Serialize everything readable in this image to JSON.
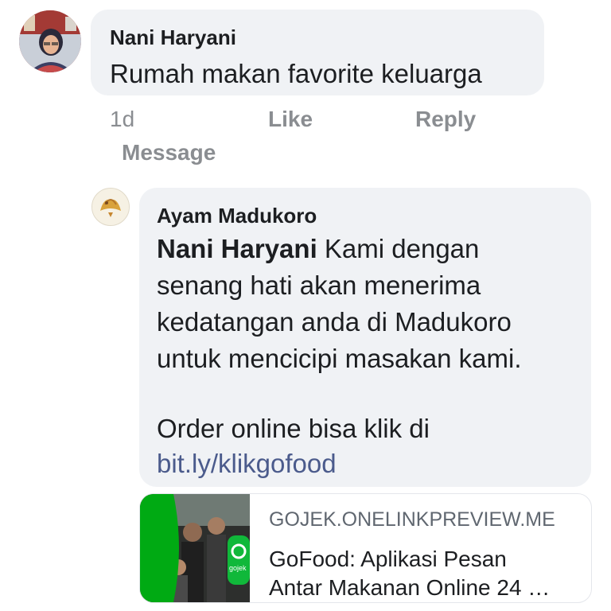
{
  "comment": {
    "author": "Nani Haryani",
    "text": "Rumah makan favorite keluarga",
    "time": "1d",
    "like": "Like",
    "reply": "Reply",
    "message": "Message"
  },
  "reply": {
    "author": "Ayam Madukoro",
    "mention": "Nani Haryani",
    "line1": "Kami dengan",
    "line2": "senang hati akan menerima",
    "line3": "kedatangan anda di Madukoro",
    "line4": "untuk mencicipi masakan kami.",
    "line5": "Order online bisa klik di",
    "link": "bit.ly/klikgofood"
  },
  "preview": {
    "domain": "GOJEK.ONELINKPREVIEW.ME",
    "title_line1": "GoFood: Aplikasi Pesan",
    "title_line2": "Antar Makanan Online 24 …",
    "thumb_badge": "gojek"
  },
  "colors": {
    "bubble": "#f0f2f5",
    "action_gray": "#8a8d91",
    "link": "#4b5b8c",
    "gojek_green": "#00aa13"
  }
}
